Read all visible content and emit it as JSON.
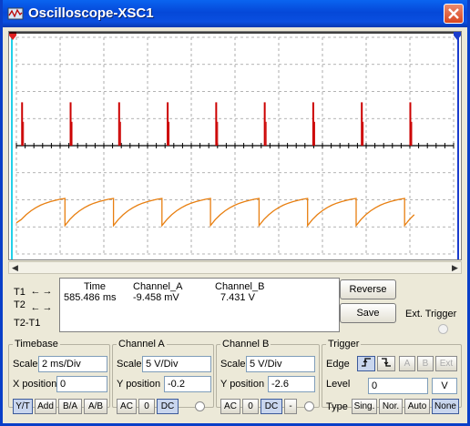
{
  "window": {
    "title": "Oscilloscope-XSC1"
  },
  "cursors": {
    "t1": "T1",
    "t2": "T2",
    "t2_t1": "T2-T1"
  },
  "readout": {
    "headers": {
      "time": "Time",
      "channel_a": "Channel_A",
      "channel_b": "Channel_B"
    },
    "row": {
      "time": "585.486 ms",
      "channel_a": "-9.458 mV",
      "channel_b": "7.431  V"
    }
  },
  "buttons": {
    "reverse": "Reverse",
    "save": "Save",
    "ext_trigger": "Ext. Trigger"
  },
  "timebase": {
    "legend": "Timebase",
    "scale_label": "Scale",
    "scale_value": "2 ms/Div",
    "xpos_label": "X position",
    "xpos_value": "0",
    "modes": [
      "Y/T",
      "Add",
      "B/A",
      "A/B"
    ]
  },
  "channel_a": {
    "legend": "Channel A",
    "scale_label": "Scale",
    "scale_value": "5  V/Div",
    "ypos_label": "Y position",
    "ypos_value": "-0.2",
    "coupling": [
      "AC",
      "0",
      "DC"
    ]
  },
  "channel_b": {
    "legend": "Channel B",
    "scale_label": "Scale",
    "scale_value": "5  V/Div",
    "ypos_label": "Y position",
    "ypos_value": "-2.6",
    "coupling": [
      "AC",
      "0",
      "DC",
      "-"
    ]
  },
  "trigger": {
    "legend": "Trigger",
    "edge_label": "Edge",
    "edge_buttons": [
      "f",
      "t",
      "A",
      "B",
      "Ext"
    ],
    "level_label": "Level",
    "level_value": "0",
    "level_unit": "V",
    "type_label": "Type",
    "types": [
      "Sing.",
      "Nor.",
      "Auto",
      "None"
    ]
  },
  "colors": {
    "channel_a": "#cc0000",
    "channel_b": "#e87f10",
    "cursor_t1": "#22d0e8",
    "cursor_t2": "#1a3ccc"
  },
  "chart_data": {
    "type": "line",
    "grid": true,
    "divisions": {
      "x": 10,
      "y": 8
    },
    "series": [
      {
        "values": {
          "kind": "spike-train",
          "pulse_times_div": [
            0.13,
            1.24,
            2.35,
            3.46,
            4.57,
            5.68,
            6.79,
            7.9,
            9.01
          ],
          "baseline_div": 0,
          "peak_div": 1.6
        }
      },
      {
        "values": {
          "kind": "sawtooth",
          "period_div": 1.11,
          "low_div": -2.95,
          "high_div": -1.95
        }
      }
    ]
  }
}
